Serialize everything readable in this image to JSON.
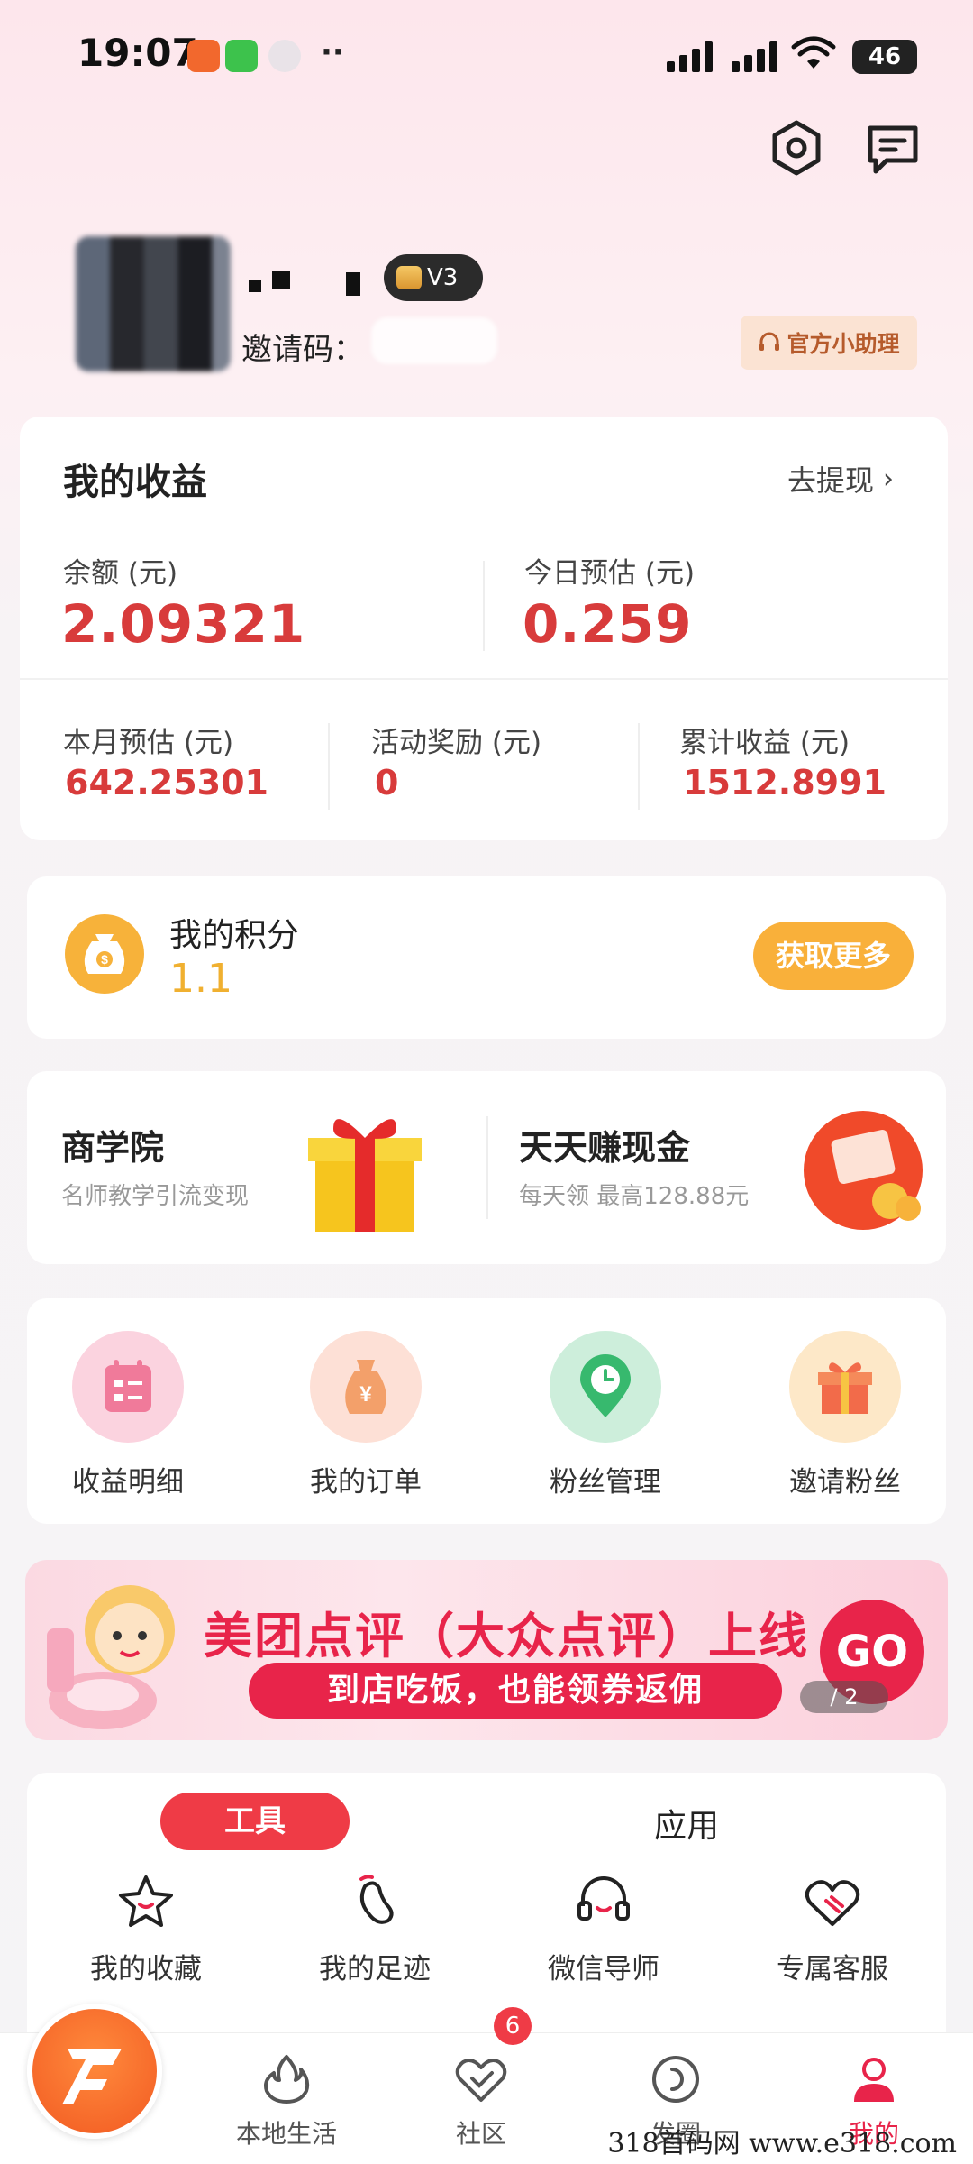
{
  "status_bar": {
    "time": "19:07",
    "battery": "46",
    "dots": "··"
  },
  "profile": {
    "vip_level": "V3",
    "invite_label": "邀请码：",
    "assistant_button": "官方小助理"
  },
  "earnings": {
    "title": "我的收益",
    "withdraw": "去提现",
    "balance_label": "余额 (元)",
    "balance_value": "2.09321",
    "today_label": "今日预估 (元)",
    "today_value": "0.259",
    "month_label": "本月预估 (元)",
    "month_value": "642.25301",
    "activity_label": "活动奖励 (元)",
    "activity_value": "0",
    "total_label": "累计收益 (元)",
    "total_value": "1512.8991"
  },
  "points": {
    "title": "我的积分",
    "value": "1.1",
    "more_button": "获取更多"
  },
  "promos": [
    {
      "title": "商学院",
      "subtitle": "名师教学引流变现"
    },
    {
      "title": "天天赚现金",
      "subtitle": "每天领 最高128.88元"
    }
  ],
  "quick_actions": [
    {
      "label": "收益明细",
      "icon": "calendar-icon",
      "color": "#fbd3df"
    },
    {
      "label": "我的订单",
      "icon": "money-bag-icon",
      "color": "#fde0d6"
    },
    {
      "label": "粉丝管理",
      "icon": "location-clock-icon",
      "color": "#cdeedb"
    },
    {
      "label": "邀请粉丝",
      "icon": "gift-icon",
      "color": "#fde8c8"
    }
  ],
  "banner": {
    "title": "美团点评（大众点评）上线",
    "subtitle": "到店吃饭，也能领券返佣",
    "go": "GO",
    "page": "/ 2"
  },
  "tools": {
    "tab_active": "工具",
    "tab_inactive": "应用",
    "items": [
      {
        "label": "我的收藏",
        "icon": "star-icon"
      },
      {
        "label": "我的足迹",
        "icon": "footprint-icon"
      },
      {
        "label": "微信导师",
        "icon": "headset-icon"
      },
      {
        "label": "专属客服",
        "icon": "heart-card-icon"
      }
    ]
  },
  "bottom_nav": {
    "items": [
      {
        "label": "本地生活",
        "icon": "flame-icon"
      },
      {
        "label": "社区",
        "icon": "check-heart-icon",
        "badge": "6"
      },
      {
        "label": "发圈",
        "icon": "circle-icon"
      },
      {
        "label": "我的",
        "icon": "person-icon"
      }
    ]
  },
  "watermark": "318首码网  www.e318.com",
  "colors": {
    "accent_red": "#e8244a",
    "value_red": "#d83b3b",
    "gold": "#f9b03a"
  }
}
